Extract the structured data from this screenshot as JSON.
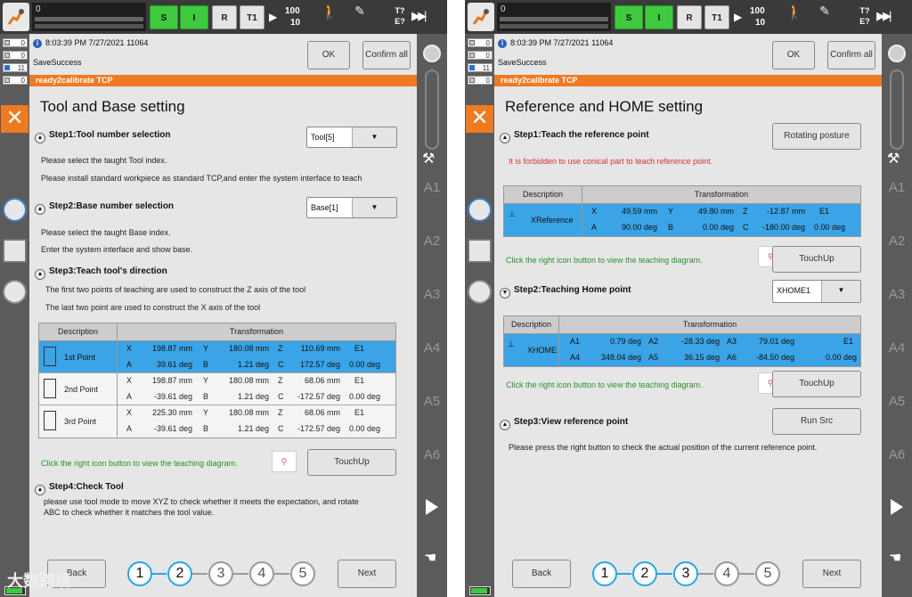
{
  "left": {
    "speed_value": "0",
    "tb_s": "S",
    "tb_i": "I",
    "tb_r": "R",
    "tb_t1": "T1",
    "speed_100": "100",
    "speed_10": "10",
    "ratio_top": "T?",
    "ratio_bottom": "E?",
    "indicators": [
      "0",
      "0",
      "11",
      "0"
    ],
    "header_time": "8:03:39 PM 7/27/2021   11064",
    "header_status": "SaveSuccess",
    "ok_label": "OK",
    "confirm_label": "Confirm all",
    "orange_text": "ready2calibrate TCP",
    "title": "Tool and Base setting",
    "step1": "Step1:Tool number selection",
    "tool_dropdown": "Tool[5]",
    "step1_txt1": "Please select the taught Tool index.",
    "step1_txt2": "Please install standard workpiece as standard TCP,and enter the system interface to teach",
    "step2": "Step2:Base number selection",
    "base_dropdown": "Base[1]",
    "step2_txt1": "Please select the taught Base index.",
    "step2_txt2": "Enter the system interface and show base.",
    "step3": "Step3:Teach tool's direction",
    "step3_txt1": "The first two points of teaching are used to construct the Z axis of the tool",
    "step3_txt2": "The last two point are used to construct the X axis of the tool",
    "table_desc": "Description",
    "table_trans": "Transformation",
    "rows": [
      {
        "name": "1st Point",
        "x": "198.87 mm",
        "y": "180.08 mm",
        "z": "110.69 mm",
        "e1": "E1",
        "a": "39.61 deg",
        "b": "1.21 deg",
        "c": "172.57 deg",
        "e1v": "0.00 deg"
      },
      {
        "name": "2nd Point",
        "x": "198.87 mm",
        "y": "180.08 mm",
        "z": "68.06 mm",
        "e1": "E1",
        "a": "-39.61 deg",
        "b": "1.21 deg",
        "c": "-172.57 deg",
        "e1v": "0.00 deg"
      },
      {
        "name": "3rd Point",
        "x": "225.30 mm",
        "y": "180.08 mm",
        "z": "68.06 mm",
        "e1": "E1",
        "a": "-39.61 deg",
        "b": "1.21 deg",
        "c": "-172.57 deg",
        "e1v": "0.00 deg"
      }
    ],
    "hint": "Click the right icon button to view the teaching diagram.",
    "touchup": "TouchUp",
    "step4": "Step4:Check Tool",
    "step4_txt1": "please use tool mode to move XYZ to check whether it meets the expectation, and rotate",
    "step4_txt2": "ABC to check whether it matches the tool value.",
    "back": "Back",
    "next": "Next",
    "steps": [
      "1",
      "2",
      "3",
      "4",
      "5"
    ],
    "watermark": "大数跨境"
  },
  "right": {
    "speed_value": "0",
    "indicators": [
      "0",
      "0",
      "11",
      "0"
    ],
    "header_time": "8:03:39 PM 7/27/2021   11064",
    "header_status": "SaveSuccess",
    "ok_label": "OK",
    "confirm_label": "Confirm all",
    "orange_text": "ready2calibrate TCP",
    "title": "Reference and HOME setting",
    "step1": "Step1:Teach the reference point",
    "rotating": "Rotating posture",
    "warn": "It is forbidden to use conical part to teach reference point.",
    "ref": {
      "name": "XReference",
      "x": "49.59 mm",
      "y": "49.80 mm",
      "z": "-12.87 mm",
      "e1": "E1",
      "a": "90.00 deg",
      "b": "0.00 deg",
      "c": "-180.00 deg",
      "e1v": "0.00 deg"
    },
    "hint": "Click the right icon button to view the teaching diagram.",
    "touchup": "TouchUp",
    "step2": "Step2:Teaching Home point",
    "home_dropdown": "XHOME1",
    "home": {
      "name": "XHOME",
      "a1": "0.79 deg",
      "a2": "-28.33 deg",
      "a3": "79.01 deg",
      "e1": "E1",
      "a4": "348.04 deg",
      "a5": "36.15 deg",
      "a6": "-84.50 deg",
      "e1v": "0.00 deg"
    },
    "step3": "Step3:View reference point",
    "runsrc": "Run Src",
    "step3_txt": "Please press the right button to check the actual position of the current reference point.",
    "table_desc": "Description",
    "table_trans": "Transformation",
    "back": "Back",
    "next": "Next",
    "steps": [
      "1",
      "2",
      "3",
      "4",
      "5"
    ]
  },
  "axes": [
    "A1",
    "A2",
    "A3",
    "A4",
    "A5",
    "A6"
  ],
  "colors": {
    "accent": "#3aa4e6",
    "orange": "#f07a22",
    "green": "#3fc93f"
  }
}
